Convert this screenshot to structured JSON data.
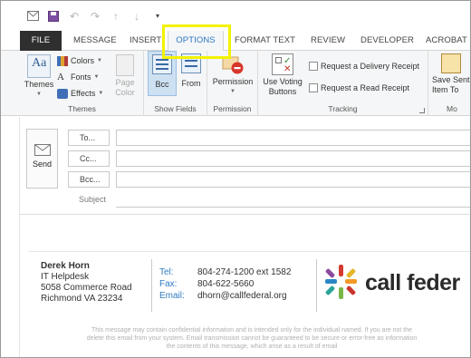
{
  "quick_access": {
    "icons": [
      "mail-icon",
      "save-icon",
      "undo-icon",
      "redo-icon",
      "up-arrow-icon",
      "down-arrow-icon",
      "customize-icon"
    ]
  },
  "tabs": [
    {
      "label": "FILE"
    },
    {
      "label": "MESSAGE"
    },
    {
      "label": "INSERT"
    },
    {
      "label": "OPTIONS",
      "active": true
    },
    {
      "label": "FORMAT TEXT"
    },
    {
      "label": "REVIEW"
    },
    {
      "label": "DEVELOPER"
    },
    {
      "label": "ACROBAT"
    }
  ],
  "ribbon": {
    "themes_group": {
      "label": "Themes",
      "themes_button": "Themes",
      "colors": "Colors",
      "fonts": "Fonts",
      "effects": "Effects",
      "page_color": "Page Color"
    },
    "show_fields_group": {
      "label": "Show Fields",
      "bcc": "Bcc",
      "from": "From"
    },
    "permission_group": {
      "label": "Permission",
      "permission": "Permission"
    },
    "tracking_group": {
      "label": "Tracking",
      "voting": "Use Voting Buttons",
      "delivery_receipt": "Request a Delivery Receipt",
      "read_receipt": "Request a Read Receipt"
    },
    "more_group": {
      "label": "Mo",
      "save_sent": "Save Sent Item To"
    }
  },
  "compose": {
    "send": "Send",
    "to": "To...",
    "cc": "Cc...",
    "bcc": "Bcc...",
    "subject": "Subject"
  },
  "signature": {
    "name": "Derek Horn",
    "title": "IT Helpdesk",
    "address1": "5058 Commerce Road",
    "address2": "Richmond VA 23234",
    "tel_label": "Tel:",
    "tel": "804-274-1200 ext 1582",
    "fax_label": "Fax:",
    "fax": "804-622-5660",
    "email_label": "Email:",
    "email": "dhorn@callfederal.org",
    "logo_text": "call feder"
  },
  "disclaimer": {
    "line1": "This message may contain confidential information and is intended only for the individual named. If you are not the",
    "line2": "delete this email from your system. Email transmission cannot be guaranteed to be secure or error-free as information",
    "line3": "the contents of this message, which arise as a result of email"
  },
  "colors": {
    "accent": "#2b78c5",
    "highlight": "#f3f200",
    "file_tab": "#2f2f2f"
  }
}
